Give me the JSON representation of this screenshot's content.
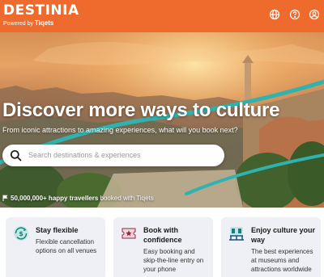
{
  "header": {
    "logo": "DESTINIA",
    "powered_by": "Powered by",
    "powered_brand": "Tiqets",
    "icons": [
      "globe-icon",
      "help-icon",
      "account-icon"
    ]
  },
  "hero": {
    "title": "Discover more ways to culture",
    "subtitle": "From iconic attractions to amazing experiences, what will you book next?",
    "search_placeholder": "Search destinations & experiences",
    "stat_bold": "50,000,000+ happy travellers",
    "stat_rest": " booked with Tiqets"
  },
  "features": [
    {
      "icon": "dollar-refresh-icon",
      "title": "Stay flexible",
      "description": "Flexible cancellation options on all venues"
    },
    {
      "icon": "ticket-star-icon",
      "title": "Book with confidence",
      "description": "Easy booking and skip-the-line entry on your phone"
    },
    {
      "icon": "museum-icon",
      "title": "Enjoy culture your way",
      "description": "The best experiences at museums and attractions worldwide"
    }
  ],
  "colors": {
    "brand": "#ef6b2d",
    "card_bg": "#eef0f5",
    "accent_teal": "#2fb3b0"
  }
}
